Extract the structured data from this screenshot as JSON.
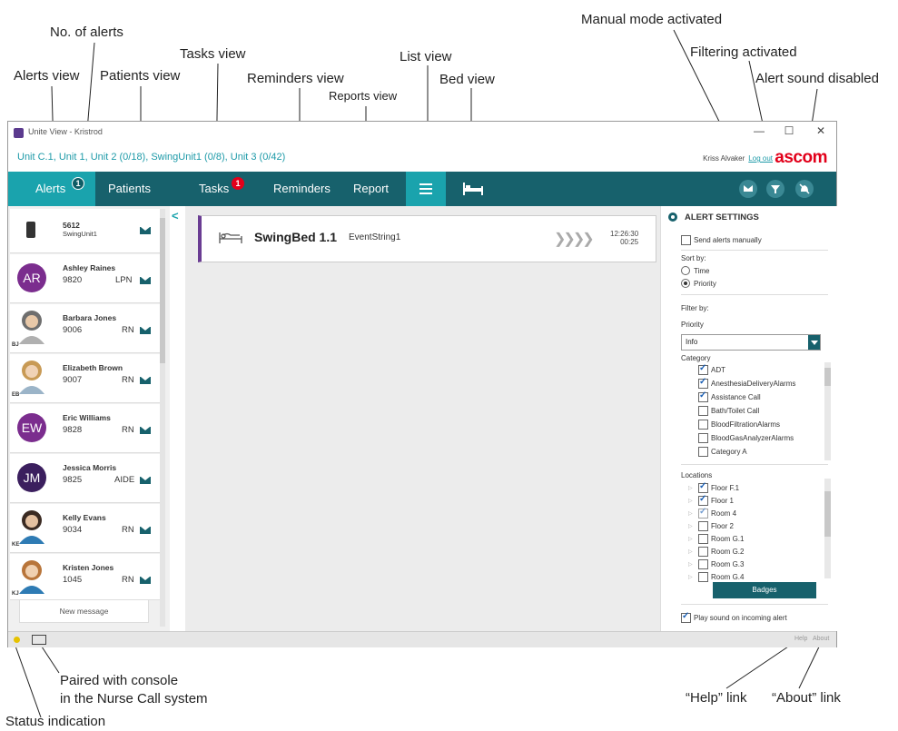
{
  "callouts": {
    "no_of_alerts": "No. of alerts",
    "tasks_view": "Tasks view",
    "alerts_view": "Alerts view",
    "patients_view": "Patients view",
    "reminders_view": "Reminders view",
    "reports_view": "Reports view",
    "list_view": "List view",
    "bed_view": "Bed view",
    "manual_mode": "Manual mode activated",
    "filtering": "Filtering activated",
    "sound_disabled": "Alert sound disabled",
    "paired_line1": "Paired with console",
    "paired_line2": "in the Nurse Call system",
    "status_indication": "Status indication",
    "help_link": "“Help” link",
    "about_link": "“About” link"
  },
  "window": {
    "title": "Unite View - Kristrod",
    "minimize": "—",
    "maximize": "☐",
    "close": "✕"
  },
  "header": {
    "units": "Unit C.1, Unit 1, Unit 2 (0/18), SwingUnit1 (0/8), Unit 3 (0/42)",
    "user": "Kriss Alvaker",
    "logout": "Log out",
    "logo": "ascom"
  },
  "nav": {
    "alerts": "Alerts",
    "alerts_count": "1",
    "patients": "Patients",
    "tasks": "Tasks",
    "tasks_count": "1",
    "reminders": "Reminders",
    "report": "Report"
  },
  "contacts": [
    {
      "name": "5612",
      "sub": "SwingUnit1",
      "number": "",
      "role": ""
    },
    {
      "name": "Ashley Raines",
      "initials": "AR",
      "number": "9820",
      "role": "LPN",
      "color": "#7b2d8e"
    },
    {
      "name": "Barbara Jones",
      "tag": "BJ",
      "number": "9006",
      "role": "RN"
    },
    {
      "name": "Elizabeth Brown",
      "tag": "EB",
      "number": "9007",
      "role": "RN"
    },
    {
      "name": "Eric Williams",
      "initials": "EW",
      "number": "9828",
      "role": "RN",
      "color": "#7b2d8e"
    },
    {
      "name": "Jessica Morris",
      "initials": "JM",
      "number": "9825",
      "role": "AIDE",
      "color": "#3b1f5e"
    },
    {
      "name": "Kelly Evans",
      "tag": "KE",
      "number": "9034",
      "role": "RN"
    },
    {
      "name": "Kristen Jones",
      "tag": "KJ",
      "number": "1045",
      "role": "RN"
    }
  ],
  "new_message": "New message",
  "collapse": "<",
  "alert": {
    "bed": "SwingBed 1.1",
    "event": "EventString1",
    "time1": "12:26:30",
    "time2": "00:25"
  },
  "settings": {
    "title": "ALERT SETTINGS",
    "send_manually": "Send alerts manually",
    "sort_by": "Sort by:",
    "sort_time": "Time",
    "sort_priority": "Priority",
    "filter_by": "Filter by:",
    "priority_label": "Priority",
    "priority_value": "Info",
    "category_label": "Category",
    "categories": [
      "ADT",
      "AnesthesiaDeliveryAlarms",
      "Assistance Call",
      "Bath/Toilet Call",
      "BloodFiltrationAlarms",
      "BloodGasAnalyzerAlarms",
      "Category A"
    ],
    "categories_checked": [
      true,
      true,
      true,
      false,
      false,
      false,
      false
    ],
    "locations_label": "Locations",
    "locations": [
      "Floor F.1",
      "Floor 1",
      "Room 4",
      "Floor 2",
      "Room G.1",
      "Room G.2",
      "Room G.3",
      "Room G.4"
    ],
    "locations_checked": [
      true,
      true,
      true,
      false,
      false,
      false,
      false,
      false
    ],
    "badges_button": "Badges",
    "play_sound": "Play sound on incoming alert"
  },
  "footer": {
    "help": "Help",
    "about": "About"
  }
}
